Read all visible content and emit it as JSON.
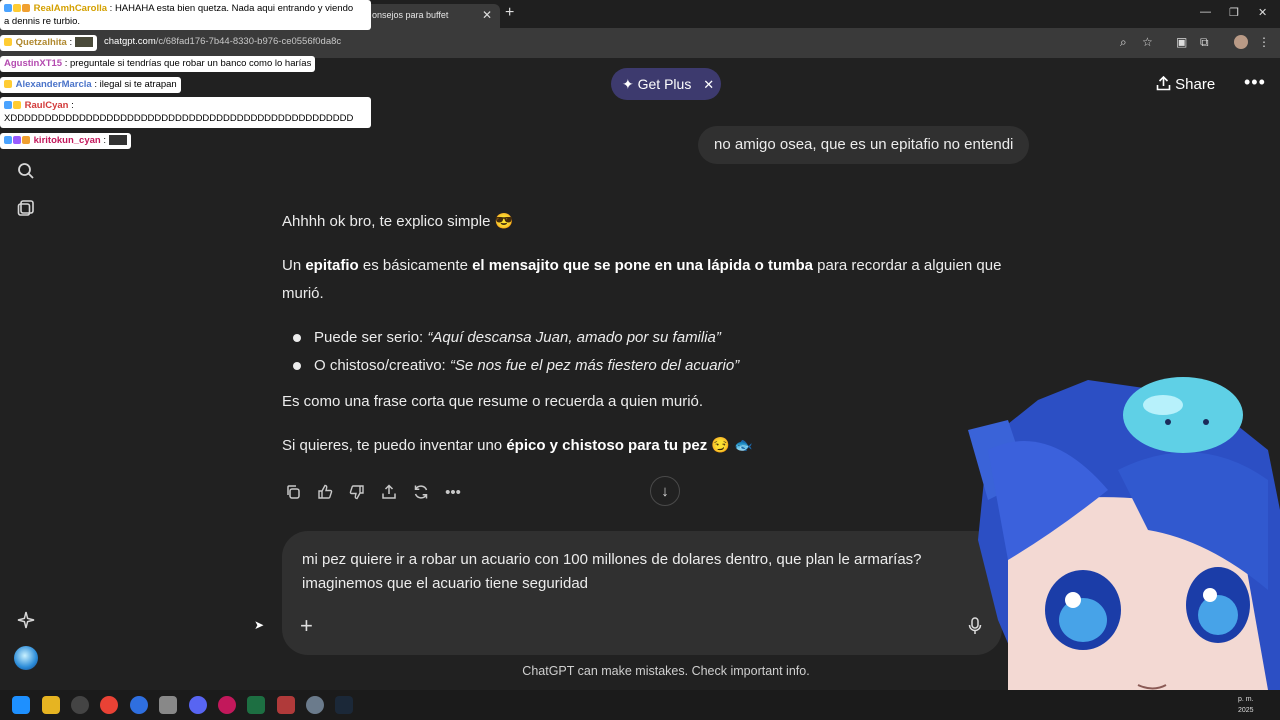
{
  "browser": {
    "tab_title": "onsejos para buffet",
    "new_tab_label": "+",
    "url_host": "chatgpt.com",
    "url_path": "/c/68fad176-7b44-8330-b976-ce0556f0da8c"
  },
  "header": {
    "get_plus_label": "Get Plus",
    "share_label": "Share"
  },
  "conversation": {
    "user_message": "no amigo osea, que es un epitafio no entendi",
    "reply": {
      "intro": "Ahhhh ok bro, te explico simple 😎",
      "p1_a": "Un ",
      "p1_b": "epitafio",
      "p1_c": " es básicamente ",
      "p1_d": "el mensajito que se pone en una lápida o tumba",
      "p1_e": " para recordar a alguien que murió.",
      "bullet1_a": "Puede ser serio: ",
      "bullet1_b": "“Aquí descansa Juan, amado por su familia”",
      "bullet2_a": "O chistoso/creativo: ",
      "bullet2_b": "“Se nos fue el pez más fiestero del acuario”",
      "p2": "Es como una frase corta que resume o recuerda a quien murió.",
      "p3_a": "Si quieres, te puedo inventar uno ",
      "p3_b": "épico y chistoso para tu pez",
      "p3_c": " 😏 🐟"
    }
  },
  "composer": {
    "text": "mi pez quiere ir a robar un acuario con 100 millones de dolares dentro, que plan le armarías? imaginemos que el acuario tiene seguridad"
  },
  "disclaimer": "ChatGPT can make mistakes. Check important info.",
  "stream_chat": [
    {
      "user": "RealAmhCarolla",
      "text": ": HAHAHA esta bien quetza. Nada aqui entrando y viendo",
      "text2": "a dennis re turbio.",
      "color": "#d4a000"
    },
    {
      "user": "Quetzalhita",
      "text": ":",
      "color": "#b0892f"
    },
    {
      "user": "AgustinXT15",
      "text": ": preguntale si tendrías que robar un banco como lo harías",
      "color": "#b44bb0"
    },
    {
      "user": "AlexanderMarcla",
      "text": ": ilegal si te atrapan",
      "color": "#4a73c9"
    },
    {
      "user": "RaulCyan",
      "text": ":",
      "text2": "XDDDDDDDDDDDDDDDDDDDDDDDDDDDDDDDDDDDDDDDDDDDDDDDDDD",
      "color": "#d23a3a"
    },
    {
      "user": "kiritokun_cyan",
      "text": ":",
      "color": "#c2185b"
    }
  ],
  "taskbar": {
    "time_line1": "p. m.",
    "time_line2": "2025"
  },
  "colors": {
    "background": "#212121",
    "bubble": "#303030",
    "get_plus_bg": "#3d3a6e"
  }
}
